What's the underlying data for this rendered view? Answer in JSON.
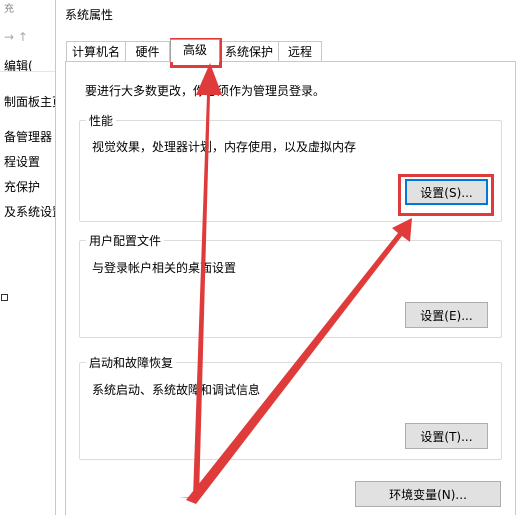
{
  "background_window": {
    "lines": [
      "充",
      "编辑(",
      "制面板主页",
      "备管理器",
      "程设置",
      "充保护",
      "及系统设置"
    ]
  },
  "dialog": {
    "title": "系统属性",
    "tabs": [
      {
        "label": "计算机名"
      },
      {
        "label": "硬件"
      },
      {
        "label": "高级",
        "active": true
      },
      {
        "label": "系统保护"
      },
      {
        "label": "远程"
      }
    ],
    "notice": "要进行大多数更改，你必须作为管理员登录。",
    "groups": {
      "performance": {
        "title": "性能",
        "description": "视觉效果，处理器计划，内存使用，以及虚拟内存",
        "button": "设置(S)..."
      },
      "user_profiles": {
        "title": "用户配置文件",
        "description": "与登录帐户相关的桌面设置",
        "button": "设置(E)..."
      },
      "startup_recovery": {
        "title": "启动和故障恢复",
        "description": "系统启动、系统故障和调试信息",
        "button": "设置(T)..."
      }
    },
    "env_button": "环境变量(N)..."
  },
  "annotation_color": "#e03b3b"
}
